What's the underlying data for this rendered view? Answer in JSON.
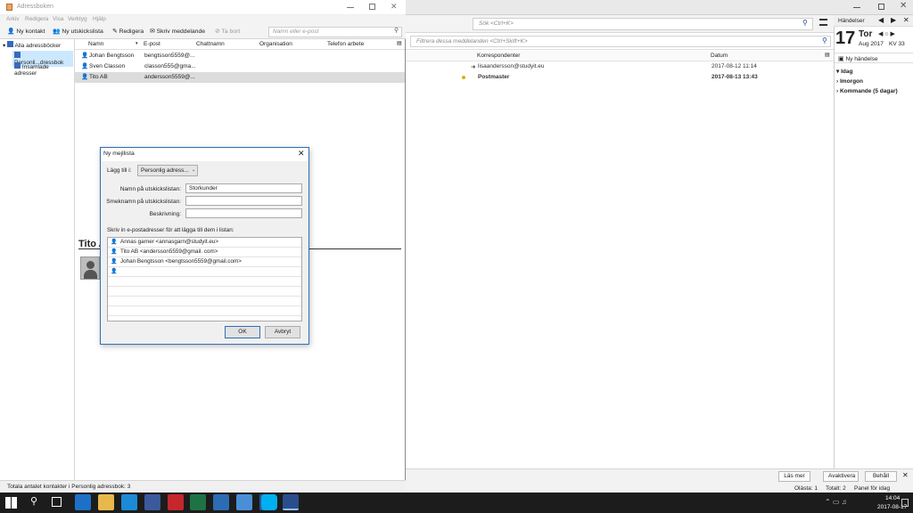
{
  "thunderbird": {
    "search_placeholder": "Sök <Ctrl+K>",
    "filter_placeholder": "Filtrera dessa meddelanden <Ctrl+Skift+K>",
    "columns": {
      "correspondent": "Korrespondenter",
      "date": "Datum"
    },
    "messages": [
      {
        "from": "lisaandersson@studyit.eu",
        "date": "2017-08-12 11:14",
        "bold": false
      },
      {
        "from": "Postmaster",
        "date": "2017-08-13 13:43",
        "bold": true
      }
    ],
    "bottom": {
      "learn_more": "Läs mer",
      "disable": "Avaktivera",
      "keep": "Behåll",
      "unread": "Olästa: 1",
      "total": "Totalt: 2",
      "today_panel": "Panel för idag"
    }
  },
  "calendar": {
    "header": "Händelser",
    "day_number": "17",
    "day_name": "Tor",
    "month_year": "Aug 2017",
    "week": "KV 33",
    "new_event": "Ny händelse",
    "groups": [
      "Idag",
      "Imorgon",
      "Kommande (5 dagar)"
    ]
  },
  "addressbook": {
    "title": "Adressboken",
    "menu": [
      "Arkiv",
      "Redigera",
      "Visa",
      "Verktyg",
      "Hjälp"
    ],
    "toolbar": {
      "new_contact": "Ny kontakt",
      "new_list": "Ny utskickslista",
      "edit": "Redigera",
      "write": "Skriv meddelande",
      "delete": "Ta bort"
    },
    "search_placeholder": "Namn eller e-post",
    "tree": {
      "root": "Alla adressböcker",
      "items": [
        "Personli...dressbok",
        "Insamlade adresser"
      ]
    },
    "columns": {
      "name": "Namn",
      "email": "E-post",
      "chat": "Chattnamn",
      "org": "Organisation",
      "phone": "Telefon arbete"
    },
    "contacts": [
      {
        "name": "Johan Bengtsson",
        "email": "bengtsson5559@..."
      },
      {
        "name": "Sven Classon",
        "email": "classon555@gma..."
      },
      {
        "name": "Tito AB",
        "email": "andersson5559@..."
      }
    ],
    "card_name": "Tito A",
    "status": "Totala antalet kontakter i Personlig adressbok: 3"
  },
  "dialog": {
    "title": "Ny mejllista",
    "add_to_label": "Lägg till i:",
    "add_to_value": "Personlig adress...",
    "name_label": "Namn på utskickslistan:",
    "name_value": "Storkunder",
    "nick_label": "Smeknamn på utskickslistan:",
    "nick_value": "",
    "desc_label": "Beskrivning:",
    "desc_value": "",
    "list_instruction": "Skriv in e-postadresser för att lägga till dem i listan:",
    "entries": [
      "Annas garner <annasgarn@studyit.eu>",
      "Tito AB <andersson5559@gmail. com>",
      "Johan Bengtsson <bengtsson5559@gmail.com>"
    ],
    "ok": "OK",
    "cancel": "Avbryt"
  },
  "taskbar": {
    "time": "14:04",
    "date": "2017-08-17"
  },
  "colors": {
    "accent": "#2f6fb8",
    "taskbar": "#1c1c1c",
    "selected": "#cce8ff"
  }
}
